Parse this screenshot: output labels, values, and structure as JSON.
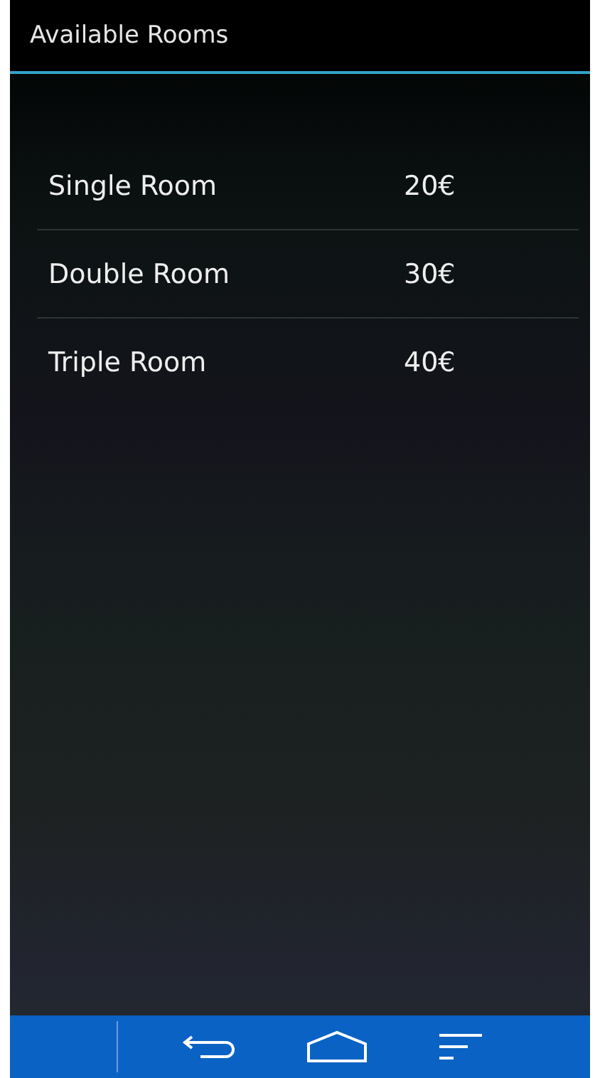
{
  "action_bar": {
    "title": "Available Rooms"
  },
  "rooms": [
    {
      "name": "Single Room",
      "price": "20€",
      "divider": true
    },
    {
      "name": "Double Room",
      "price": "30€",
      "divider": true
    },
    {
      "name": "Triple Room",
      "price": "40€",
      "divider": false
    }
  ]
}
